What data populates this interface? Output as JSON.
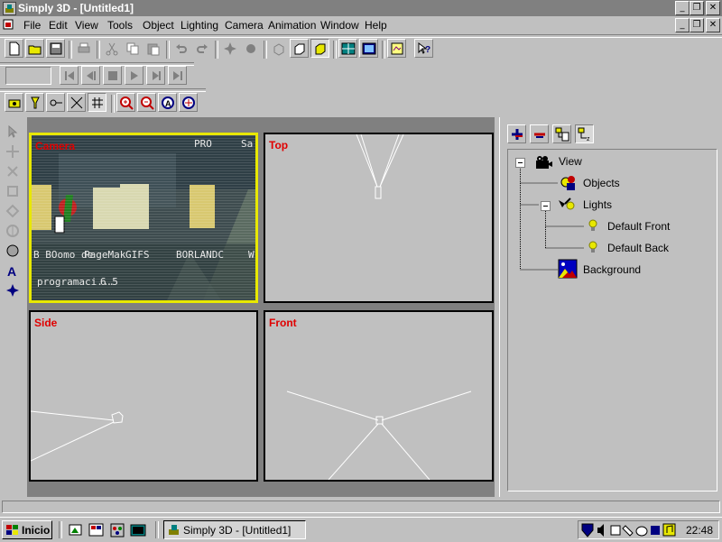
{
  "window": {
    "title": "Simply 3D - [Untitled1]"
  },
  "menu": [
    "File",
    "Edit",
    "View",
    "Tools",
    "Object",
    "Lighting",
    "Camera",
    "Animation",
    "Window",
    "Help"
  ],
  "viewports": {
    "camera": {
      "label": "Camera",
      "texts": [
        "PRO",
        "Sa",
        "B BOomo de",
        "PageMak",
        "GIFS",
        "BORLANDC",
        "W",
        "programaci...",
        "6.5"
      ]
    },
    "top": {
      "label": "Top"
    },
    "side": {
      "label": "Side"
    },
    "front": {
      "label": "Front"
    }
  },
  "tree": {
    "view": "View",
    "objects": "Objects",
    "lights": "Lights",
    "default_front": "Default Front",
    "default_back": "Default Back",
    "background": "Background"
  },
  "taskbar": {
    "start_label": "Inicio",
    "task_label": "Simply 3D - [Untitled1]",
    "clock": "22:48"
  },
  "colors": {
    "viewport_label": "#e00000",
    "selected_border": "#e8e800",
    "title_bar": "#808080"
  }
}
